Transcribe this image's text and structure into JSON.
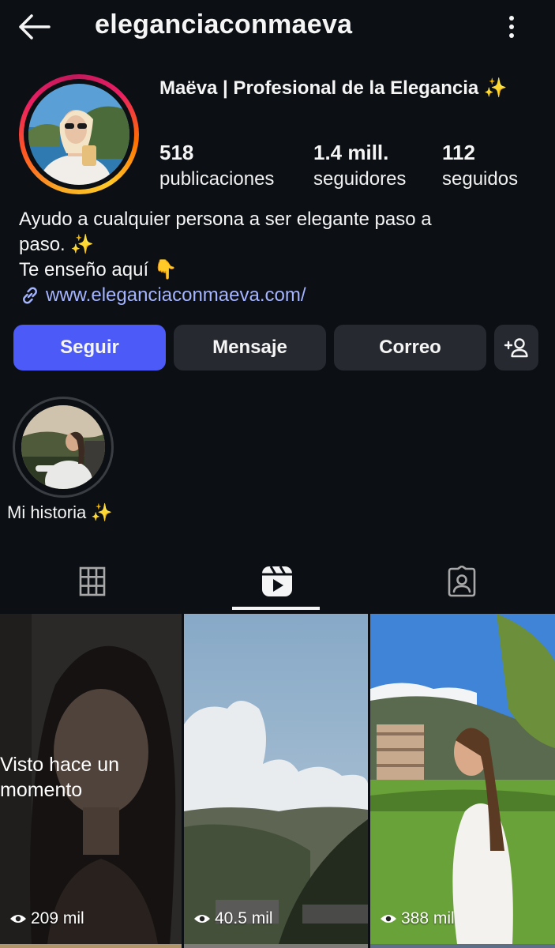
{
  "header": {
    "username": "eleganciaconmaeva"
  },
  "profile": {
    "display_name": "Maëva | Profesional de la Elegancia ✨",
    "stats": [
      {
        "value": "518",
        "label": "publicaciones"
      },
      {
        "value": "1.4 mill.",
        "label": "seguidores"
      },
      {
        "value": "112",
        "label": "seguidos"
      }
    ],
    "bio_lines": [
      "Ayudo a cualquier persona a ser elegante paso a",
      "paso. ✨",
      "Te enseño aquí 👇"
    ],
    "link": "www.eleganciaconmaeva.com/"
  },
  "buttons": {
    "follow": "Seguir",
    "message": "Mensaje",
    "email": "Correo"
  },
  "highlight": {
    "label": "Mi historia ✨"
  },
  "tabs": [
    "grid-icon",
    "reels-icon",
    "tagged-icon"
  ],
  "active_tab": "reels",
  "reels": [
    {
      "views": "209 mil",
      "overlay": "Visto hace un momento",
      "overlay_lines": [
        "Visto hace un",
        "momento"
      ]
    },
    {
      "views": "40.5 mil"
    },
    {
      "views": "388 mil"
    }
  ],
  "colors": {
    "background": "#0c1014",
    "primary_button": "#4c5bf7",
    "secondary_button": "#262a30",
    "link": "#a5b4ff"
  }
}
